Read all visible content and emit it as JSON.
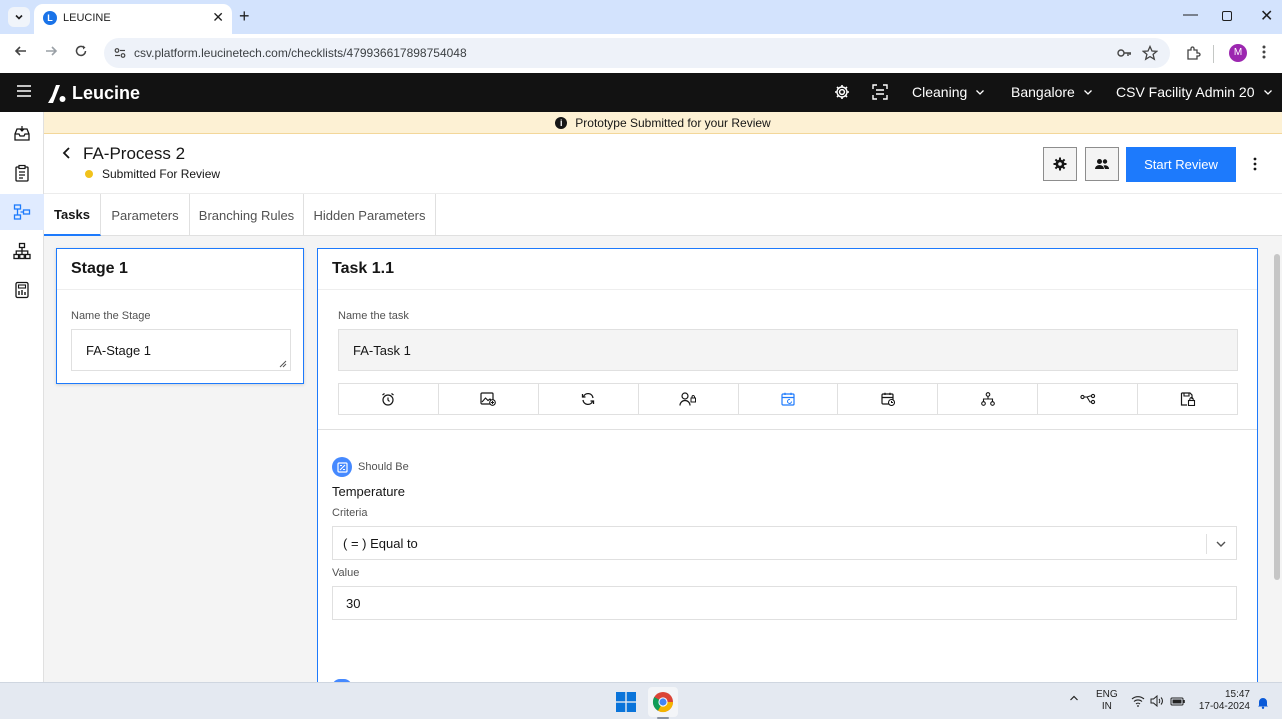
{
  "browser": {
    "tab_title": "LEUCINE",
    "tab_favicon_letter": "L",
    "url": "csv.platform.leucinetech.com/checklists/479936617898754048",
    "profile_initial": "M",
    "new_tab_glyph": "+",
    "close_glyph": "✕",
    "minimize_glyph": "—"
  },
  "app": {
    "brand": "Leucine",
    "header": {
      "dropdowns": [
        "Cleaning",
        "Bangalore",
        "CSV Facility Admin 20"
      ]
    },
    "banner": "Prototype Submitted for your Review",
    "process": {
      "title": "FA-Process 2",
      "status": "Submitted For Review",
      "status_color": "#f1c21b",
      "primary_action": "Start Review"
    },
    "tabs": [
      "Tasks",
      "Parameters",
      "Branching Rules",
      "Hidden Parameters"
    ],
    "active_tab": "Tasks",
    "stage": {
      "title": "Stage 1",
      "name_label": "Name the Stage",
      "name_value": "FA-Stage 1"
    },
    "task": {
      "title": "Task 1.1",
      "name_label": "Name the task",
      "name_value": "FA-Task 1",
      "toolbar_icons": [
        "alarm-icon",
        "media-icon",
        "recurrence-icon",
        "assign-user-icon",
        "schedule-icon",
        "due-date-icon",
        "hierarchy-icon",
        "branch-icon",
        "task-lock-icon"
      ],
      "active_tool": "schedule-icon"
    },
    "parameter": {
      "type": "Should Be",
      "name": "Temperature",
      "criteria_label": "Criteria",
      "criteria_value": "( = ) Equal to",
      "value_label": "Value",
      "value": "30"
    },
    "accent_color": "#1d7afc"
  },
  "taskbar": {
    "lang_line1": "ENG",
    "lang_line2": "IN",
    "time": "15:47",
    "date": "17-04-2024"
  }
}
